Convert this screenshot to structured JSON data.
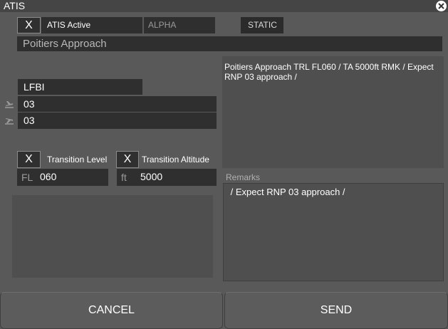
{
  "window": {
    "title": "ATIS"
  },
  "header": {
    "active_checkbox": "X",
    "active_label": "ATIS Active",
    "letter": "ALPHA",
    "mode": "STATIC"
  },
  "station_name": "Poitiers Approach",
  "airport": {
    "icao": "LFBI",
    "departure_runway": "03",
    "arrival_runway": "03"
  },
  "transition": {
    "level_checkbox": "X",
    "level_label": "Transition Level",
    "level_prefix": "FL",
    "level_value": "060",
    "altitude_checkbox": "X",
    "altitude_label": "Transition Altitude",
    "altitude_prefix": "ft",
    "altitude_value": "5000"
  },
  "preview": {
    "text": "Poitiers Approach TRL FL060 / TA 5000ft RMK  / Expect RNP 03 approach /"
  },
  "remarks": {
    "label": "Remarks",
    "text": " / Expect RNP 03 approach /"
  },
  "footer": {
    "cancel_label": "CANCEL",
    "send_label": "SEND"
  }
}
